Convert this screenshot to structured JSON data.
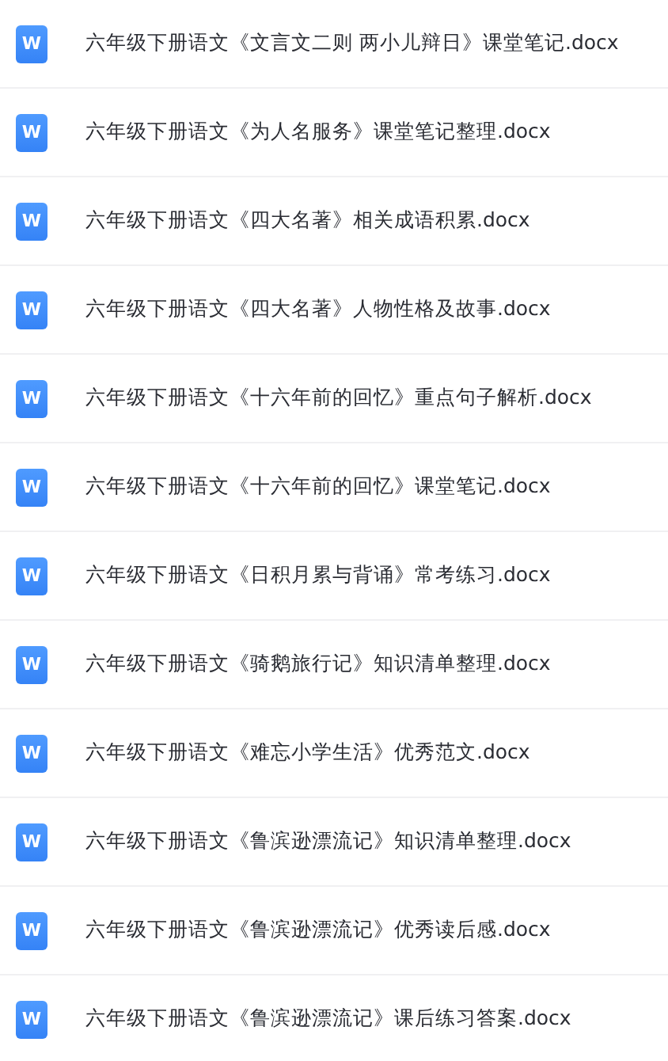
{
  "files": [
    {
      "name": "六年级下册语文《文言文二则 两小儿辩日》课堂笔记.docx",
      "icon_letter": "W"
    },
    {
      "name": "六年级下册语文《为人名服务》课堂笔记整理.docx",
      "icon_letter": "W"
    },
    {
      "name": "六年级下册语文《四大名著》相关成语积累.docx",
      "icon_letter": "W"
    },
    {
      "name": "六年级下册语文《四大名著》人物性格及故事.docx",
      "icon_letter": "W"
    },
    {
      "name": "六年级下册语文《十六年前的回忆》重点句子解析.docx",
      "icon_letter": "W"
    },
    {
      "name": "六年级下册语文《十六年前的回忆》课堂笔记.docx",
      "icon_letter": "W"
    },
    {
      "name": "六年级下册语文《日积月累与背诵》常考练习.docx",
      "icon_letter": "W"
    },
    {
      "name": "六年级下册语文《骑鹅旅行记》知识清单整理.docx",
      "icon_letter": "W"
    },
    {
      "name": "六年级下册语文《难忘小学生活》优秀范文.docx",
      "icon_letter": "W"
    },
    {
      "name": "六年级下册语文《鲁滨逊漂流记》知识清单整理.docx",
      "icon_letter": "W"
    },
    {
      "name": "六年级下册语文《鲁滨逊漂流记》优秀读后感.docx",
      "icon_letter": "W"
    },
    {
      "name": "六年级下册语文《鲁滨逊漂流记》课后练习答案.docx",
      "icon_letter": "W"
    }
  ]
}
